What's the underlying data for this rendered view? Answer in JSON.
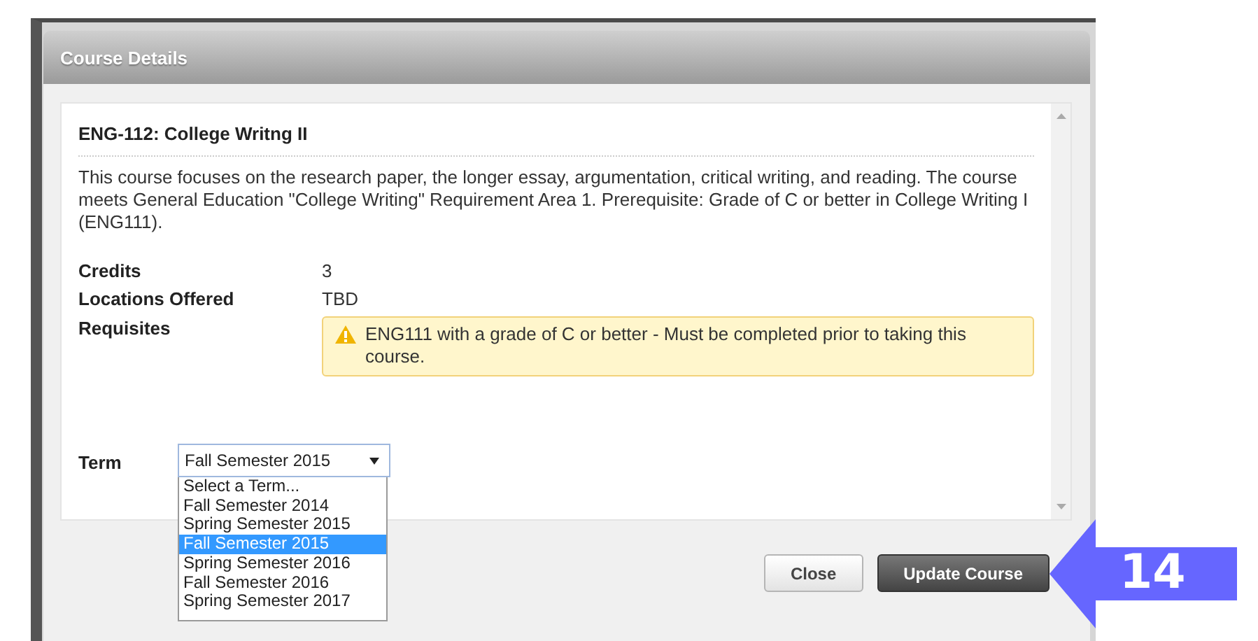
{
  "dialog": {
    "title": "Course Details"
  },
  "course": {
    "heading": "ENG-112: College Writng II",
    "description": "This course focuses on the research paper, the longer essay, argumentation, critical writing, and reading. The course meets General Education \"College Writing\" Requirement Area 1. Prerequisite: Grade of C or better in College Writing I (ENG111).",
    "details": [
      {
        "label": "Credits",
        "value": "3"
      },
      {
        "label": "Locations Offered",
        "value": "TBD"
      }
    ],
    "requisites": {
      "label": "Requisites",
      "warning": "ENG111 with a grade of C or better - Must be completed prior to taking this course."
    }
  },
  "term": {
    "label": "Term",
    "value": "Fall Semester 2015",
    "expanded": true,
    "options": [
      {
        "label": "Select a Term...",
        "selected": false
      },
      {
        "label": "Fall Semester 2014",
        "selected": false
      },
      {
        "label": "Spring Semester 2015",
        "selected": false
      },
      {
        "label": "Fall Semester 2015",
        "selected": true
      },
      {
        "label": "Spring Semester 2016",
        "selected": false
      },
      {
        "label": "Fall Semester 2016",
        "selected": false
      },
      {
        "label": "Spring Semester 2017",
        "selected": false
      }
    ]
  },
  "buttons": [
    {
      "label": "Close",
      "kind": "secondary"
    },
    {
      "label": "Update Course",
      "kind": "primary"
    }
  ],
  "callout": {
    "number": "14"
  }
}
